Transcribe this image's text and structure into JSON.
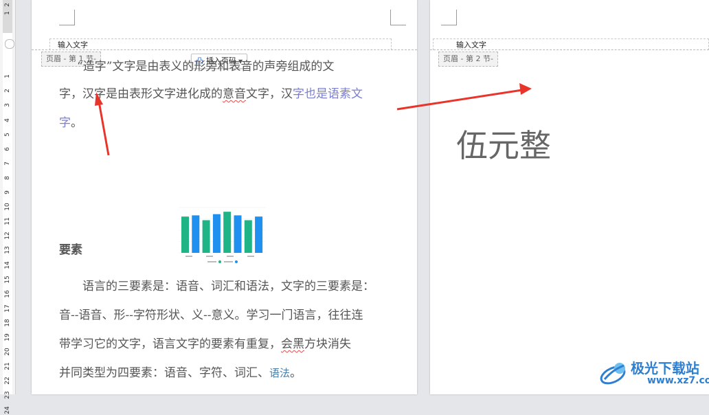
{
  "ruler": {
    "numbers": [
      "2",
      "1",
      "1",
      "2",
      "3",
      "4",
      "5",
      "6",
      "7",
      "8",
      "9",
      "10",
      "11",
      "12",
      "13",
      "14",
      "15",
      "16",
      "17",
      "18",
      "19",
      "20",
      "21",
      "22",
      "23",
      "24"
    ]
  },
  "page1": {
    "header_input": "输入文字",
    "header_tag": "页眉 - 第 1 节-",
    "insert_page_number": "插入页码",
    "lines": [
      {
        "a": "“造字”文字是由表义的形旁和表音的声旁组成的文"
      },
      {
        "a": "字，汉字是由表形文字进化成的",
        "b": "意音",
        "c": "文字，汉",
        "d": "字也是语素文"
      },
      {
        "d": "字",
        "a2": "。"
      }
    ],
    "heading": "要素",
    "para2": [
      "　　语言的三要素是：语音、词汇和语法，文字的三要素是：",
      "音--语音、形--字符形状、义--意义。学习一门语言，往往连",
      {
        "a": "带学习它的文字，语言文字的要素有重复，",
        "b": "会黑",
        "c": "方块消失"
      },
      {
        "a": "并同类型为四要素：语音、字符、词汇、",
        "t": "语法",
        "c": "。"
      }
    ],
    "embedded_chart": {
      "values": [
        60,
        62,
        54,
        64,
        68,
        62,
        54,
        60
      ],
      "colors": [
        "#1fb486",
        "#1f8ff0",
        "#1fb486",
        "#1f8ff0",
        "#1fb486",
        "#1f8ff0",
        "#1fb486",
        "#1f8ff0"
      ]
    }
  },
  "page2": {
    "header_input": "输入文字",
    "header_tag": "页眉 - 第 2 节-",
    "big_text": "伍元整"
  },
  "watermark": {
    "title": "极光下载站",
    "url": "www.xz7.com"
  },
  "colors": {
    "arrow": "#e8342a",
    "page_bg": "#ffffff",
    "workspace_bg": "#e4e6ea"
  }
}
